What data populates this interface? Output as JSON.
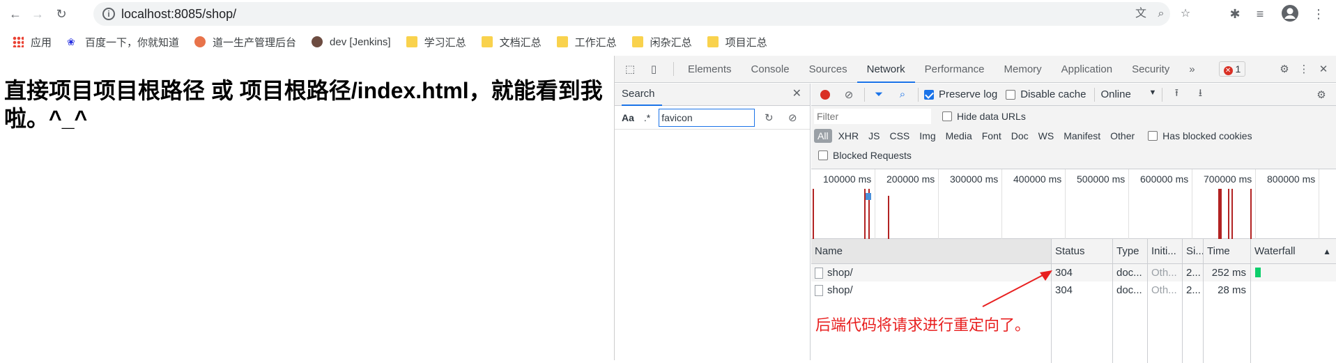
{
  "browser": {
    "url": "localhost:8085/shop/",
    "bookmarks": [
      {
        "label": "应用",
        "icon": "apps-grid-icon"
      },
      {
        "label": "百度一下，你就知道",
        "icon": "baidu-paw-icon"
      },
      {
        "label": "道一生产管理后台",
        "icon": "site-logo-icon"
      },
      {
        "label": "dev [Jenkins]",
        "icon": "jenkins-icon"
      },
      {
        "label": "学习汇总",
        "icon": "folder-icon"
      },
      {
        "label": "文档汇总",
        "icon": "folder-icon"
      },
      {
        "label": "工作汇总",
        "icon": "folder-icon"
      },
      {
        "label": "闲杂汇总",
        "icon": "folder-icon"
      },
      {
        "label": "项目汇总",
        "icon": "folder-icon"
      }
    ]
  },
  "page": {
    "heading": "直接项目项目根路径 或 项目根路径/index.html，就能看到我啦。^_^"
  },
  "devtools": {
    "tabs": [
      "Elements",
      "Console",
      "Sources",
      "Network",
      "Performance",
      "Memory",
      "Application",
      "Security"
    ],
    "active_tab": "Network",
    "more": "»",
    "error_count": "1",
    "search": {
      "title": "Search",
      "case_label": "Aa",
      "regex_label": ".*",
      "query": "favicon"
    },
    "network": {
      "preserve_log": "Preserve log",
      "disable_cache": "Disable cache",
      "throttle": "Online",
      "filter_placeholder": "Filter",
      "hide_data_urls": "Hide data URLs",
      "types": [
        "All",
        "XHR",
        "JS",
        "CSS",
        "Img",
        "Media",
        "Font",
        "Doc",
        "WS",
        "Manifest",
        "Other"
      ],
      "has_blocked_cookies": "Has blocked cookies",
      "blocked_requests": "Blocked Requests",
      "timeline_ticks": [
        "100000 ms",
        "200000 ms",
        "300000 ms",
        "400000 ms",
        "500000 ms",
        "600000 ms",
        "700000 ms",
        "800000 ms"
      ],
      "columns": [
        "Name",
        "Status",
        "Type",
        "Initi...",
        "Si...",
        "Time",
        "Waterfall"
      ],
      "rows": [
        {
          "name": "shop/",
          "status": "304",
          "type": "doc...",
          "initiator": "Oth...",
          "size": "2...",
          "time": "252 ms"
        },
        {
          "name": "shop/",
          "status": "304",
          "type": "doc...",
          "initiator": "Oth...",
          "size": "2...",
          "time": "28 ms"
        }
      ]
    }
  },
  "annotation": "后端代码将请求进行重定向了。",
  "colors": {
    "annotation": "#e82020",
    "accent": "#1a73e8",
    "record": "#d93025"
  }
}
